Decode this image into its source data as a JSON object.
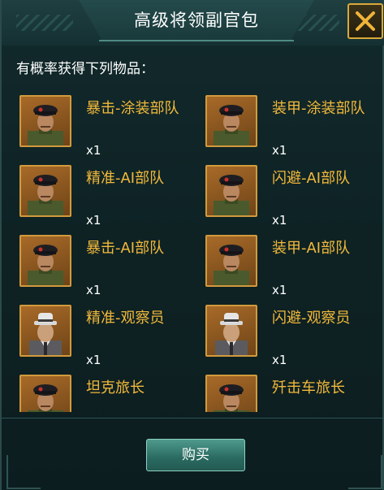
{
  "dialog": {
    "title": "高级将领副官包",
    "subtitle": "有概率获得下列物品：",
    "close_icon": "close-x-icon",
    "buy_label": "购买"
  },
  "items": [
    {
      "name": "暴击-涂装部队",
      "qty": "x1",
      "portrait": "soldier-beret"
    },
    {
      "name": "装甲-涂装部队",
      "qty": "x1",
      "portrait": "soldier-beret"
    },
    {
      "name": "精准-AI部队",
      "qty": "x1",
      "portrait": "soldier-beret"
    },
    {
      "name": "闪避-AI部队",
      "qty": "x1",
      "portrait": "soldier-beret"
    },
    {
      "name": "暴击-AI部队",
      "qty": "x1",
      "portrait": "soldier-beret"
    },
    {
      "name": "装甲-AI部队",
      "qty": "x1",
      "portrait": "soldier-beret"
    },
    {
      "name": "精准-观察员",
      "qty": "x1",
      "portrait": "agent-fedora"
    },
    {
      "name": "闪避-观察员",
      "qty": "x1",
      "portrait": "agent-fedora"
    },
    {
      "name": "坦克旅长",
      "qty": "",
      "portrait": "soldier-beret"
    },
    {
      "name": "歼击车旅长",
      "qty": "",
      "portrait": "soldier-beret"
    }
  ],
  "colors": {
    "accent_gold": "#f2b93b",
    "panel_bg": "#0e2224",
    "button_teal": "#3f8a7c"
  }
}
